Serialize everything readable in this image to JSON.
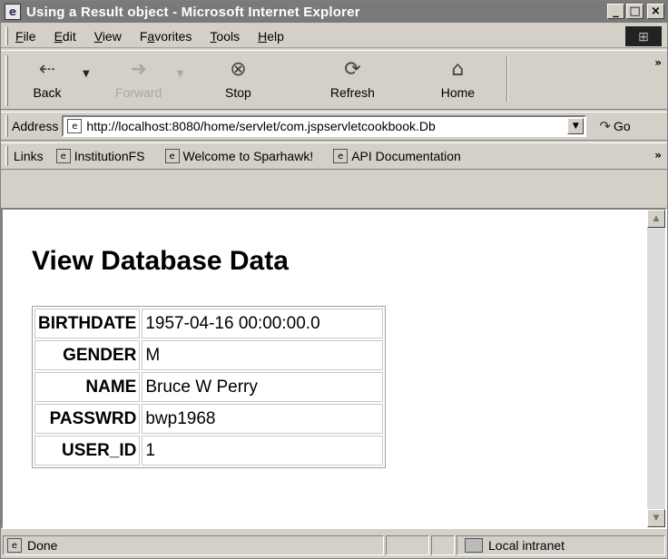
{
  "window": {
    "title": "Using a Result object - Microsoft Internet Explorer"
  },
  "menu": [
    "File",
    "Edit",
    "View",
    "Favorites",
    "Tools",
    "Help"
  ],
  "menu_access_keys": [
    "F",
    "E",
    "V",
    "a",
    "T",
    "H"
  ],
  "toolbar": {
    "back": "Back",
    "forward": "Forward",
    "stop": "Stop",
    "refresh": "Refresh",
    "home": "Home"
  },
  "address": {
    "label": "Address",
    "url": "http://localhost:8080/home/servlet/com.jspservletcookbook.Db",
    "go": "Go"
  },
  "links": {
    "label": "Links",
    "items": [
      "InstitutionFS",
      "Welcome to Sparhawk!",
      "API Documentation"
    ]
  },
  "page": {
    "heading": "View Database Data",
    "rows": [
      {
        "key": "BIRTHDATE",
        "value": "1957-04-16 00:00:00.0"
      },
      {
        "key": "GENDER",
        "value": "M"
      },
      {
        "key": "NAME",
        "value": "Bruce W Perry"
      },
      {
        "key": "PASSWRD",
        "value": "bwp1968"
      },
      {
        "key": "USER_ID",
        "value": "1"
      }
    ]
  },
  "status": {
    "text": "Done",
    "zone": "Local intranet"
  },
  "icons": {
    "app": "ie-page-icon",
    "back": "back-arrow-icon",
    "forward": "forward-arrow-icon",
    "stop": "stop-icon",
    "refresh": "refresh-icon",
    "home": "home-icon",
    "go": "go-arrow-icon"
  }
}
